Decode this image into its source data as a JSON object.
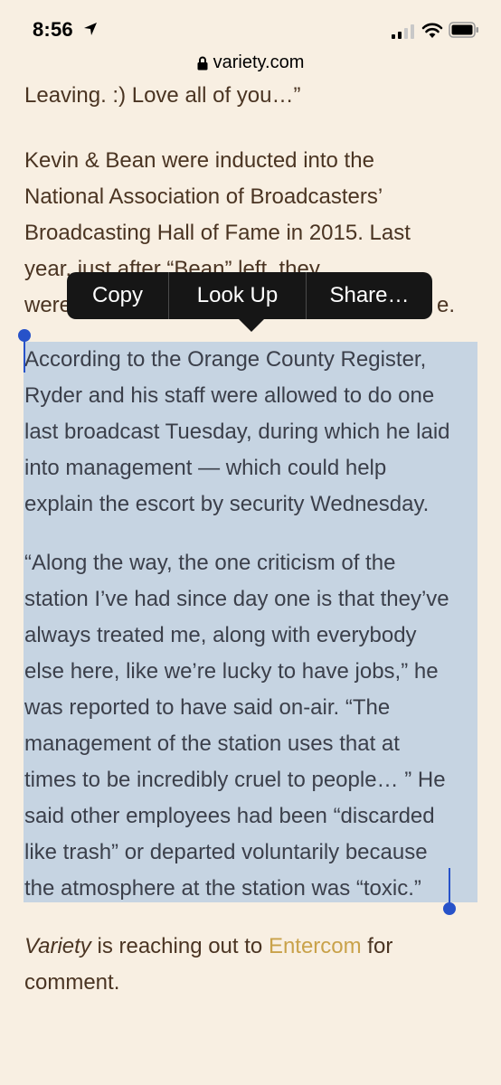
{
  "status_bar": {
    "time": "8:56"
  },
  "url_bar": {
    "domain": "variety.com"
  },
  "article": {
    "p0": "Leaving. :) Love all of you…”",
    "p1_lines": [
      "Kevin & Bean were inducted into the",
      "National Association of Broadcasters’",
      "Broadcasting Hall of Fame in 2015. Last",
      "year, just after “Bean” left, they",
      "were"
    ],
    "p1_tail": "e.",
    "p2_lines": [
      "According to the Orange County Register,",
      "Ryder and his staff were allowed to do one",
      "last broadcast Tuesday, during which he laid",
      "into management — which could help",
      "explain the escort by security Wednesday."
    ],
    "p3_lines": [
      "“Along the way, the one criticism of the",
      "station I’ve had since day one is that they’ve",
      "always treated me, along with everybody",
      "else here, like we’re lucky to have jobs,” he",
      "was reported to have said on-air. “The",
      "management of the station uses that at",
      "times to be incredibly cruel to people… ” He",
      "said other employees had been “discarded",
      "like trash” or departed voluntarily because",
      "the atmosphere at the station was “toxic.”"
    ],
    "p4": {
      "italic": "Variety",
      "text1": " is reaching out to ",
      "link": "Entercom",
      "text2": " for",
      "line2": "comment."
    }
  },
  "context_menu": {
    "copy": "Copy",
    "look_up": "Look Up",
    "share": "Share…"
  },
  "colors": {
    "background": "#f8efe2",
    "selection": "#c6d4e2",
    "handle": "#2752c9",
    "link": "#c9a24a"
  }
}
